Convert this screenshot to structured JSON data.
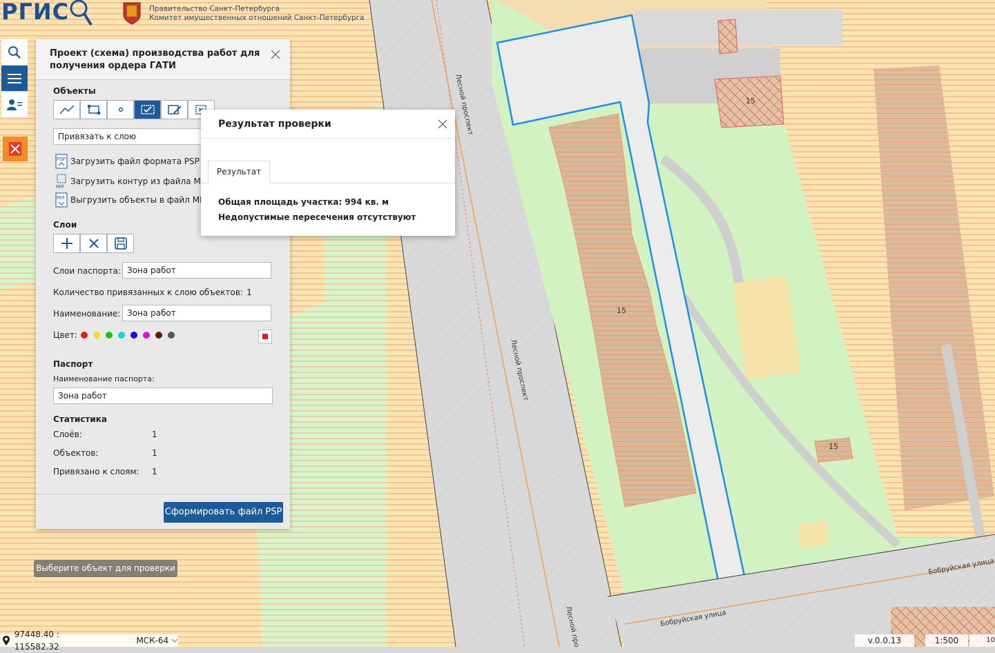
{
  "header": {
    "logo": "РГИС",
    "gov_line1": "Правительство Санкт-Петербурга",
    "gov_line2": "Комитет имущественных отношений Санкт-Петербурга"
  },
  "panel": {
    "title": "Проект (схема) производства работ для получения ордера ГАТИ",
    "objects_title": "Объекты",
    "bind_layer": "Привязать к слою",
    "load_psp": "Загрузить файл формата PSP",
    "load_mif": "Загрузить контур из файла MIF",
    "export_mif": "Выгрузить объекты в файл MIF",
    "layers_title": "Слои",
    "passport_layers_label": "Слои паспорта:",
    "passport_layers_value": "Зона работ",
    "bound_count_label": "Количество привязанных к слою объектов:",
    "bound_count_value": "1",
    "name_label": "Наименование:",
    "name_value": "Зона работ",
    "color_label": "Цвет:",
    "colors": [
      "#e21c1c",
      "#e8e020",
      "#20c020",
      "#10d8d8",
      "#1010e0",
      "#e010e0",
      "#601818",
      "#555555"
    ],
    "passport_title": "Паспорт",
    "passport_name_label": "Наименование паспорта:",
    "passport_name_value": "Зона работ",
    "stats_title": "Статистика",
    "stats": [
      {
        "label": "Слоёв:",
        "value": "1"
      },
      {
        "label": "Объектов:",
        "value": "1"
      },
      {
        "label": "Привязано к слоям:",
        "value": "1"
      }
    ],
    "psp_button": "Сформировать файл PSP"
  },
  "dialog": {
    "title": "Результат проверки",
    "tab": "Результат",
    "line1": "Общая площадь участка: 994 кв. м",
    "line2": "Недопустимые пересечения отсутствуют"
  },
  "tooltip": "Выберите объект для проверки",
  "map": {
    "street1": "Лесной проспект",
    "street2": "Лесной проспект",
    "street3": "Лесной про",
    "street4": "Бобруйская улица",
    "street5": "Бобруйская улица",
    "label_a": "15",
    "label_b": "15",
    "label_c": "15"
  },
  "status": {
    "coords": "97448.40 : 115582.32",
    "crs": "МСК-64",
    "version": "v.0.0.13",
    "scale": "1:500",
    "extra": "10"
  }
}
